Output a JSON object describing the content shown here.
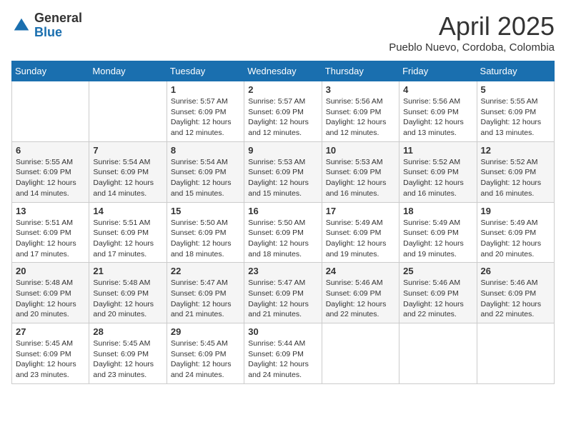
{
  "header": {
    "logo_general": "General",
    "logo_blue": "Blue",
    "month": "April 2025",
    "location": "Pueblo Nuevo, Cordoba, Colombia"
  },
  "days_of_week": [
    "Sunday",
    "Monday",
    "Tuesday",
    "Wednesday",
    "Thursday",
    "Friday",
    "Saturday"
  ],
  "weeks": [
    [
      {
        "day": "",
        "sunrise": "",
        "sunset": "",
        "daylight": ""
      },
      {
        "day": "",
        "sunrise": "",
        "sunset": "",
        "daylight": ""
      },
      {
        "day": "1",
        "sunrise": "Sunrise: 5:57 AM",
        "sunset": "Sunset: 6:09 PM",
        "daylight": "Daylight: 12 hours and 12 minutes."
      },
      {
        "day": "2",
        "sunrise": "Sunrise: 5:57 AM",
        "sunset": "Sunset: 6:09 PM",
        "daylight": "Daylight: 12 hours and 12 minutes."
      },
      {
        "day": "3",
        "sunrise": "Sunrise: 5:56 AM",
        "sunset": "Sunset: 6:09 PM",
        "daylight": "Daylight: 12 hours and 12 minutes."
      },
      {
        "day": "4",
        "sunrise": "Sunrise: 5:56 AM",
        "sunset": "Sunset: 6:09 PM",
        "daylight": "Daylight: 12 hours and 13 minutes."
      },
      {
        "day": "5",
        "sunrise": "Sunrise: 5:55 AM",
        "sunset": "Sunset: 6:09 PM",
        "daylight": "Daylight: 12 hours and 13 minutes."
      }
    ],
    [
      {
        "day": "6",
        "sunrise": "Sunrise: 5:55 AM",
        "sunset": "Sunset: 6:09 PM",
        "daylight": "Daylight: 12 hours and 14 minutes."
      },
      {
        "day": "7",
        "sunrise": "Sunrise: 5:54 AM",
        "sunset": "Sunset: 6:09 PM",
        "daylight": "Daylight: 12 hours and 14 minutes."
      },
      {
        "day": "8",
        "sunrise": "Sunrise: 5:54 AM",
        "sunset": "Sunset: 6:09 PM",
        "daylight": "Daylight: 12 hours and 15 minutes."
      },
      {
        "day": "9",
        "sunrise": "Sunrise: 5:53 AM",
        "sunset": "Sunset: 6:09 PM",
        "daylight": "Daylight: 12 hours and 15 minutes."
      },
      {
        "day": "10",
        "sunrise": "Sunrise: 5:53 AM",
        "sunset": "Sunset: 6:09 PM",
        "daylight": "Daylight: 12 hours and 16 minutes."
      },
      {
        "day": "11",
        "sunrise": "Sunrise: 5:52 AM",
        "sunset": "Sunset: 6:09 PM",
        "daylight": "Daylight: 12 hours and 16 minutes."
      },
      {
        "day": "12",
        "sunrise": "Sunrise: 5:52 AM",
        "sunset": "Sunset: 6:09 PM",
        "daylight": "Daylight: 12 hours and 16 minutes."
      }
    ],
    [
      {
        "day": "13",
        "sunrise": "Sunrise: 5:51 AM",
        "sunset": "Sunset: 6:09 PM",
        "daylight": "Daylight: 12 hours and 17 minutes."
      },
      {
        "day": "14",
        "sunrise": "Sunrise: 5:51 AM",
        "sunset": "Sunset: 6:09 PM",
        "daylight": "Daylight: 12 hours and 17 minutes."
      },
      {
        "day": "15",
        "sunrise": "Sunrise: 5:50 AM",
        "sunset": "Sunset: 6:09 PM",
        "daylight": "Daylight: 12 hours and 18 minutes."
      },
      {
        "day": "16",
        "sunrise": "Sunrise: 5:50 AM",
        "sunset": "Sunset: 6:09 PM",
        "daylight": "Daylight: 12 hours and 18 minutes."
      },
      {
        "day": "17",
        "sunrise": "Sunrise: 5:49 AM",
        "sunset": "Sunset: 6:09 PM",
        "daylight": "Daylight: 12 hours and 19 minutes."
      },
      {
        "day": "18",
        "sunrise": "Sunrise: 5:49 AM",
        "sunset": "Sunset: 6:09 PM",
        "daylight": "Daylight: 12 hours and 19 minutes."
      },
      {
        "day": "19",
        "sunrise": "Sunrise: 5:49 AM",
        "sunset": "Sunset: 6:09 PM",
        "daylight": "Daylight: 12 hours and 20 minutes."
      }
    ],
    [
      {
        "day": "20",
        "sunrise": "Sunrise: 5:48 AM",
        "sunset": "Sunset: 6:09 PM",
        "daylight": "Daylight: 12 hours and 20 minutes."
      },
      {
        "day": "21",
        "sunrise": "Sunrise: 5:48 AM",
        "sunset": "Sunset: 6:09 PM",
        "daylight": "Daylight: 12 hours and 20 minutes."
      },
      {
        "day": "22",
        "sunrise": "Sunrise: 5:47 AM",
        "sunset": "Sunset: 6:09 PM",
        "daylight": "Daylight: 12 hours and 21 minutes."
      },
      {
        "day": "23",
        "sunrise": "Sunrise: 5:47 AM",
        "sunset": "Sunset: 6:09 PM",
        "daylight": "Daylight: 12 hours and 21 minutes."
      },
      {
        "day": "24",
        "sunrise": "Sunrise: 5:46 AM",
        "sunset": "Sunset: 6:09 PM",
        "daylight": "Daylight: 12 hours and 22 minutes."
      },
      {
        "day": "25",
        "sunrise": "Sunrise: 5:46 AM",
        "sunset": "Sunset: 6:09 PM",
        "daylight": "Daylight: 12 hours and 22 minutes."
      },
      {
        "day": "26",
        "sunrise": "Sunrise: 5:46 AM",
        "sunset": "Sunset: 6:09 PM",
        "daylight": "Daylight: 12 hours and 22 minutes."
      }
    ],
    [
      {
        "day": "27",
        "sunrise": "Sunrise: 5:45 AM",
        "sunset": "Sunset: 6:09 PM",
        "daylight": "Daylight: 12 hours and 23 minutes."
      },
      {
        "day": "28",
        "sunrise": "Sunrise: 5:45 AM",
        "sunset": "Sunset: 6:09 PM",
        "daylight": "Daylight: 12 hours and 23 minutes."
      },
      {
        "day": "29",
        "sunrise": "Sunrise: 5:45 AM",
        "sunset": "Sunset: 6:09 PM",
        "daylight": "Daylight: 12 hours and 24 minutes."
      },
      {
        "day": "30",
        "sunrise": "Sunrise: 5:44 AM",
        "sunset": "Sunset: 6:09 PM",
        "daylight": "Daylight: 12 hours and 24 minutes."
      },
      {
        "day": "",
        "sunrise": "",
        "sunset": "",
        "daylight": ""
      },
      {
        "day": "",
        "sunrise": "",
        "sunset": "",
        "daylight": ""
      },
      {
        "day": "",
        "sunrise": "",
        "sunset": "",
        "daylight": ""
      }
    ]
  ]
}
